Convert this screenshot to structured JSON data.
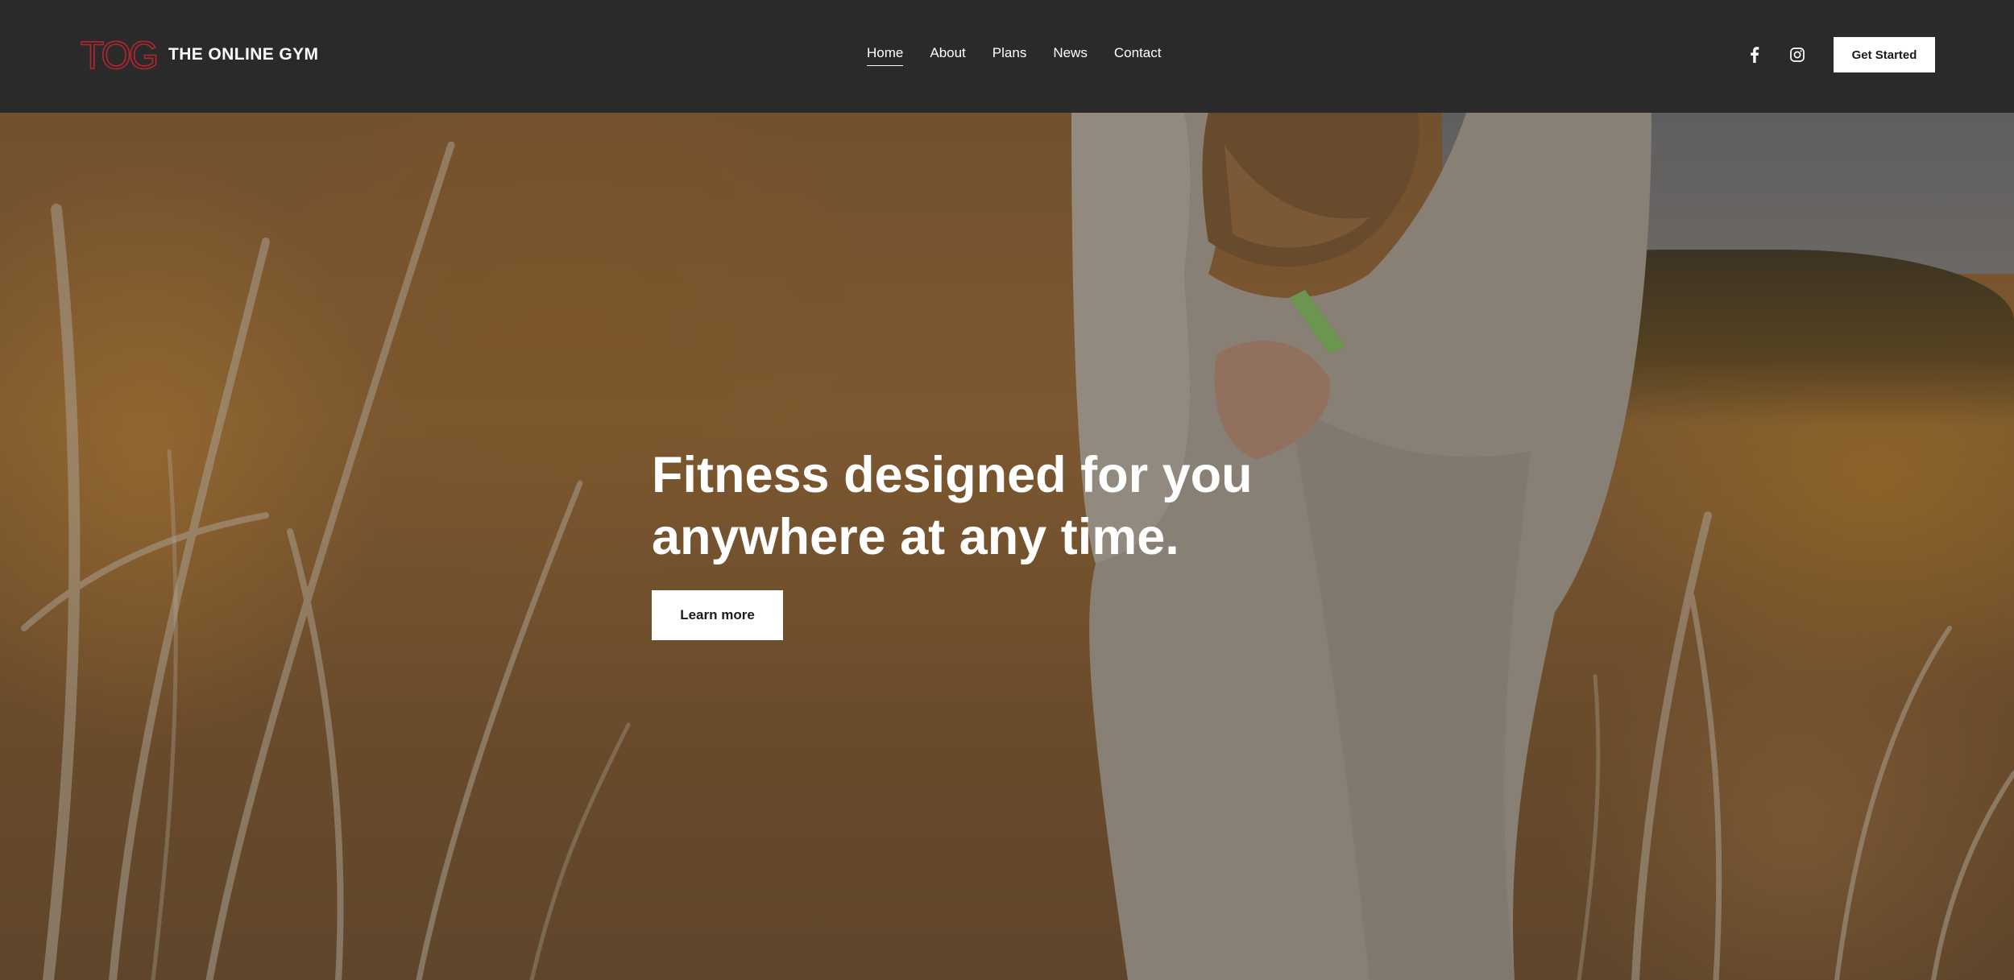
{
  "brand": {
    "logo_mark": "TOG",
    "name": "THE ONLINE GYM",
    "logo_color": "#b3262f"
  },
  "nav": {
    "items": [
      {
        "label": "Home",
        "active": true
      },
      {
        "label": "About",
        "active": false
      },
      {
        "label": "Plans",
        "active": false
      },
      {
        "label": "News",
        "active": false
      },
      {
        "label": "Contact",
        "active": false
      }
    ]
  },
  "social": {
    "icons": [
      "facebook-icon",
      "instagram-icon"
    ]
  },
  "header": {
    "cta_label": "Get Started"
  },
  "hero": {
    "title_line1": "Fitness designed for you",
    "title_line2": "anywhere at any time.",
    "button_label": "Learn more"
  },
  "colors": {
    "header_bg": "#2b2a2b",
    "text": "#ffffff",
    "button_bg": "#ffffff",
    "button_text": "#1c1c1c"
  }
}
